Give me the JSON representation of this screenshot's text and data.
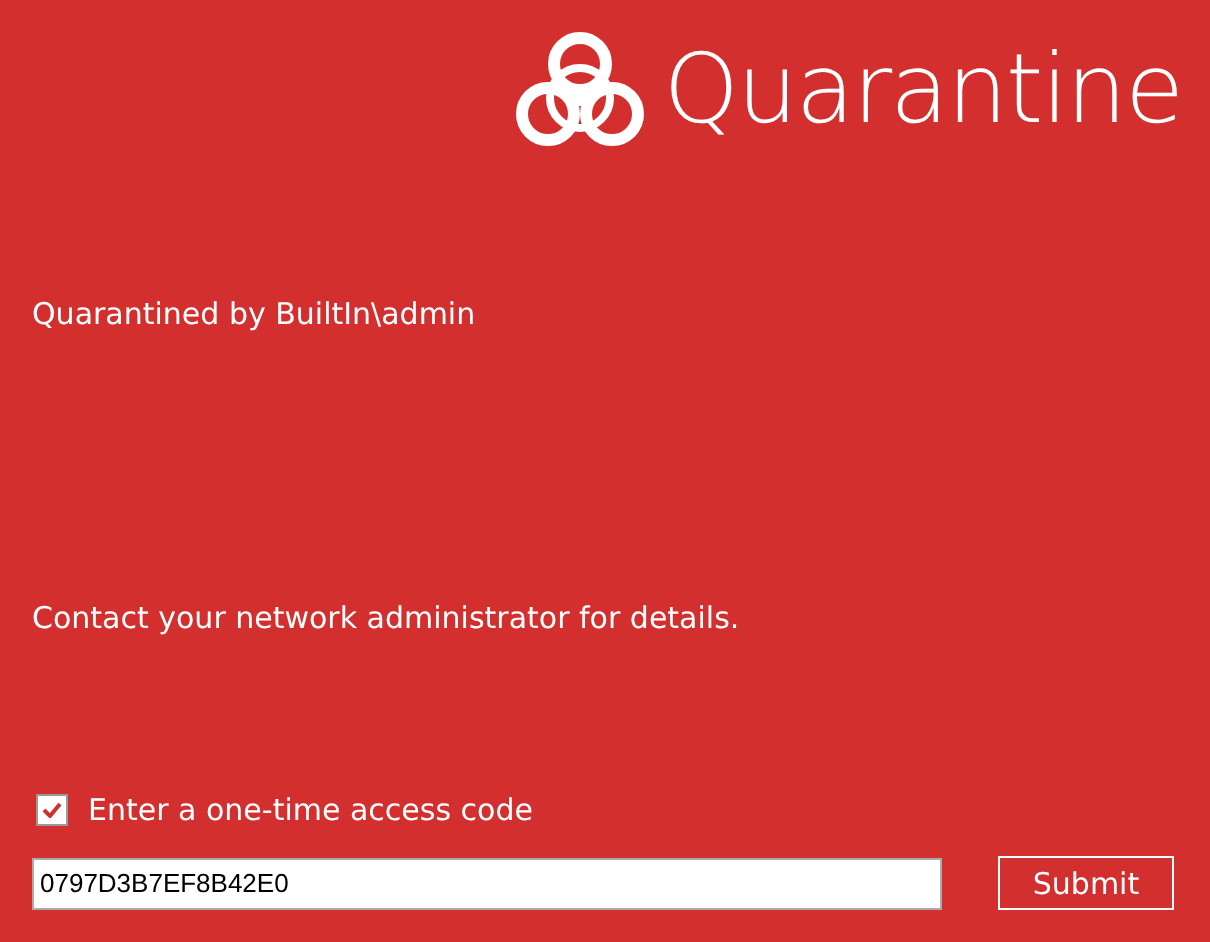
{
  "title": "Quarantine",
  "quarantined_by": "Quarantined by BuiltIn\\admin",
  "message": "Contact your network administrator for details.",
  "access_code": {
    "label": "Enter a one-time access code",
    "checked": true,
    "value": "0797D3B7EF8B42E0"
  },
  "submit": "Submit"
}
